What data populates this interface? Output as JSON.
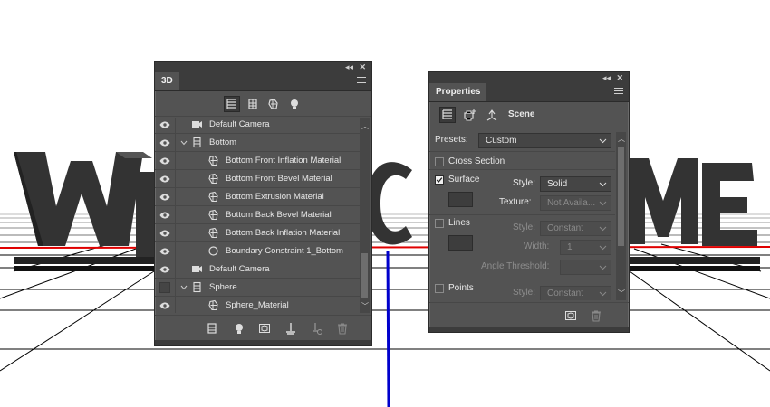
{
  "colors": {
    "panel_bg": "#535353",
    "panel_header": "#3c3c3c",
    "ground_line": "#000000",
    "red_axis": "#e00000",
    "blue_axis": "#0000cc",
    "letters": "#3a3a3a"
  },
  "scene": {
    "letters_left": "WE",
    "letter_mid": "C",
    "letters_right": "ME"
  },
  "panel_3d": {
    "tab_label": "3D",
    "collapse_icon": "double-chevron-icon",
    "close_icon": "close-icon",
    "filter_icons": [
      "whole-scene-icon",
      "meshes-icon",
      "materials-icon",
      "lights-icon"
    ],
    "rows": [
      {
        "label": "Default Camera",
        "icon": "camera-icon",
        "visible": true
      },
      {
        "label": "Bottom",
        "icon": "mesh-icon",
        "visible": true,
        "expanded": true
      },
      {
        "label": "Bottom Front Inflation Material",
        "icon": "material-icon",
        "visible": true
      },
      {
        "label": "Bottom Front Bevel Material",
        "icon": "material-icon",
        "visible": true
      },
      {
        "label": "Bottom Extrusion Material",
        "icon": "material-icon",
        "visible": true
      },
      {
        "label": "Bottom Back Bevel Material",
        "icon": "material-icon",
        "visible": true
      },
      {
        "label": "Bottom Back Inflation Material",
        "icon": "material-icon",
        "visible": true
      },
      {
        "label": "Boundary Constraint 1_Bottom",
        "icon": "constraint-icon",
        "visible": true
      },
      {
        "label": "Default Camera",
        "icon": "camera-icon",
        "visible": true
      },
      {
        "label": "Sphere",
        "icon": "mesh-icon",
        "visible": false,
        "expanded": true
      },
      {
        "label": "Sphere_Material",
        "icon": "material-icon",
        "visible": true
      }
    ],
    "bottom_icons": [
      "add-mesh-icon",
      "add-light-icon",
      "render-icon",
      "ground-icon",
      "constraint-add-icon",
      "trash-icon"
    ]
  },
  "panel_props": {
    "tab_label": "Properties",
    "scene_label": "Scene",
    "presets_label": "Presets:",
    "presets_value": "Custom",
    "cross_section_label": "Cross Section",
    "cross_section_checked": false,
    "surface_label": "Surface",
    "surface_checked": true,
    "style_label": "Style:",
    "surface_style": "Solid",
    "texture_label": "Texture:",
    "texture_value": "Not Availa...",
    "lines_label": "Lines",
    "lines_checked": false,
    "lines_style": "Constant",
    "width_label": "Width:",
    "width_value": "1",
    "angle_label": "Angle Threshold:",
    "points_label": "Points",
    "points_checked": false,
    "points_style": "Constant",
    "bottom_icons": [
      "render-icon",
      "trash-icon"
    ]
  }
}
